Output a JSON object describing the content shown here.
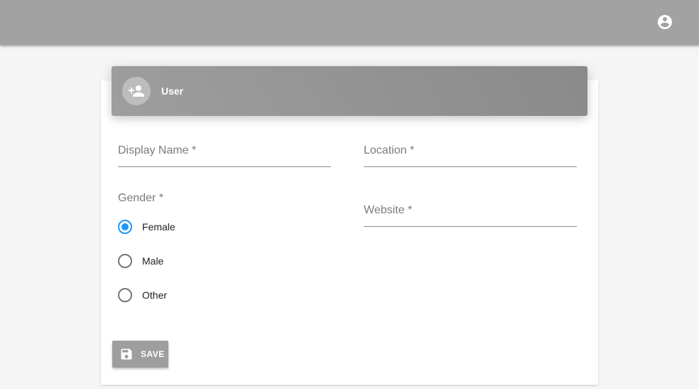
{
  "appbar": {
    "account_icon": "account-circle-icon"
  },
  "card": {
    "header": {
      "icon": "person-add-icon",
      "title": "User"
    }
  },
  "form": {
    "display_name": {
      "label": "Display Name *",
      "value": ""
    },
    "location": {
      "label": "Location *",
      "value": ""
    },
    "website": {
      "label": "Website *",
      "value": ""
    },
    "gender": {
      "label": "Gender *",
      "options": [
        "Female",
        "Male",
        "Other"
      ],
      "selected": "Female"
    },
    "save_button": {
      "label": "SAVE",
      "icon": "save-icon"
    }
  },
  "colors": {
    "appbar": "#a2a2a2",
    "header": "#8a8a8a",
    "radio_checked": "#2196f3",
    "button": "#9e9e9e",
    "background": "#f5f5f5"
  }
}
